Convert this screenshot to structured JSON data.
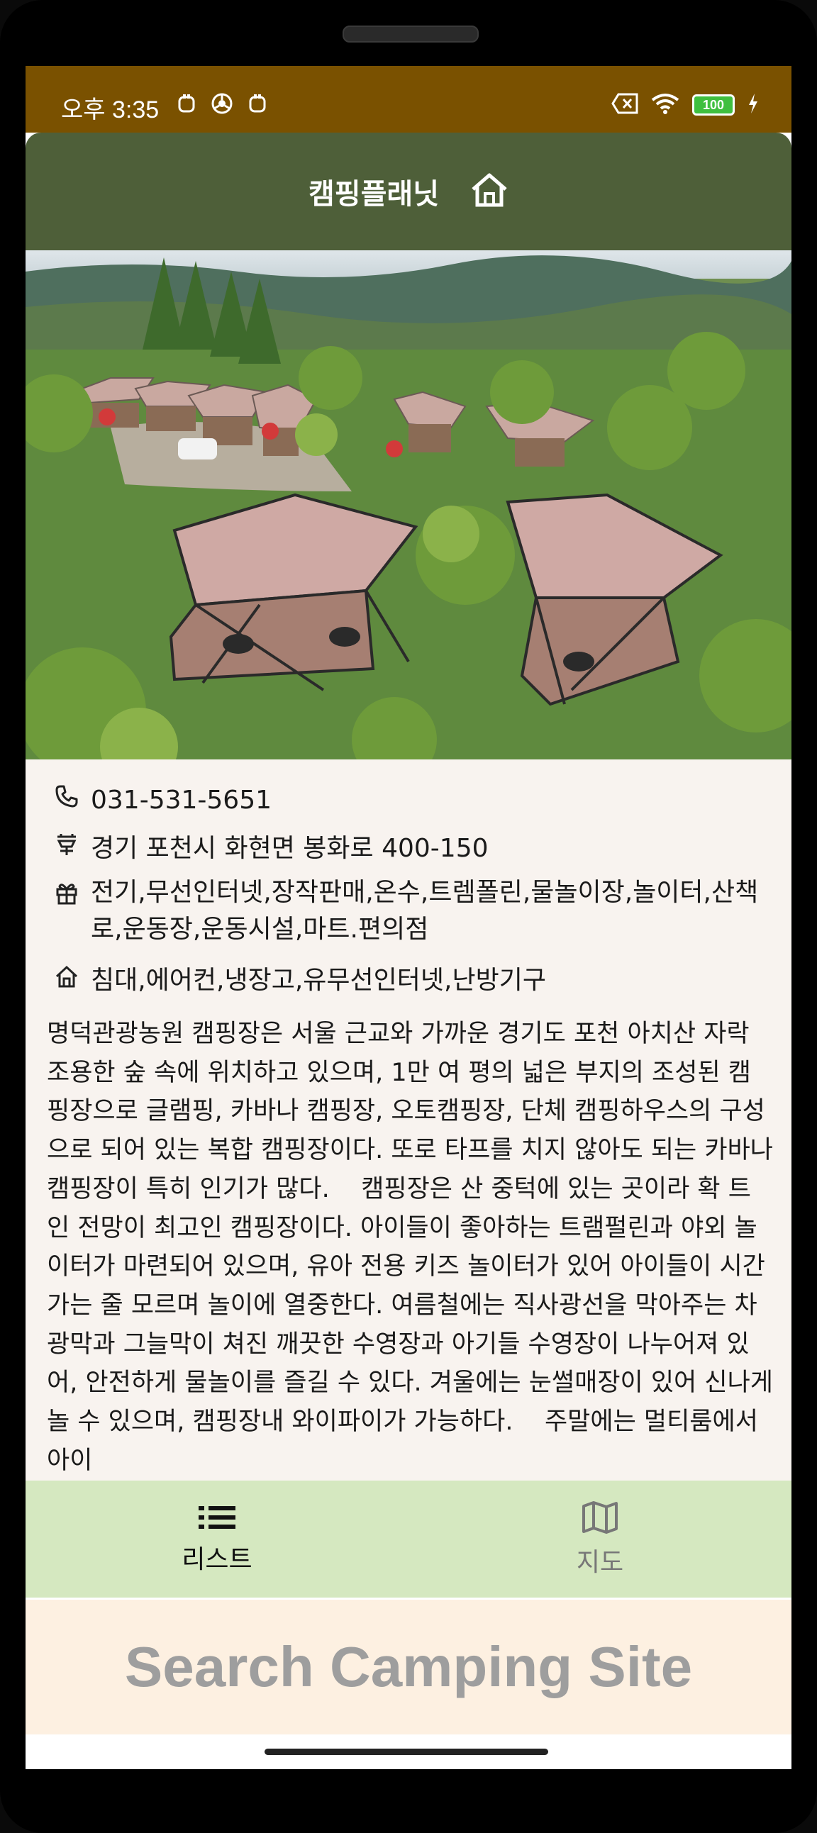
{
  "status_bar": {
    "time": "오후 3:35",
    "battery": "100"
  },
  "app_bar": {
    "title": "캠핑플래닛"
  },
  "details": {
    "phone": "031-531-5651",
    "address": "경기 포천시 화현면 봉화로 400-150",
    "amenities": "전기,무선인터넷,장작판매,온수,트렘폴린,물놀이장,놀이터,산책로,운동장,운동시설,마트.편의점",
    "facilities": "침대,에어컨,냉장고,유무선인터넷,난방기구",
    "description": "명덕관광농원 캠핑장은 서울 근교와 가까운 경기도 포천 아치산 자락 조용한 숲 속에 위치하고 있으며, 1만 여 평의 넓은 부지의 조성된 캠핑장으로 글램핑, 카바나 캠핑장, 오토캠핑장, 단체 캠핑하우스의 구성으로 되어 있는 복합 캠핑장이다. 또로 타프를 치지 않아도 되는 카바나 캠핑장이 특히 인기가 많다.    캠핑장은 산 중턱에 있는 곳이라 확 트인 전망이 최고인 캠핑장이다. 아이들이 좋아하는 트램펄린과 야외 놀이터가 마련되어 있으며, 유아 전용 키즈 놀이터가 있어 아이들이 시간가는 줄 모르며 놀이에 열중한다. 여름철에는 직사광선을 막아주는 차광막과 그늘막이 쳐진 깨끗한 수영장과 아기들 수영장이 나누어져 있어, 안전하게 물놀이를 즐길 수 있다. 겨울에는 눈썰매장이 있어 신나게 놀 수 있으며, 캠핑장내 와이파이가 가능하다.    주말에는 멀티룸에서 아이"
  },
  "bottom_nav": {
    "list_label": "리스트",
    "map_label": "지도"
  },
  "banner": {
    "text": "Search Camping Site"
  },
  "colors": {
    "status_bar": "#7a5100",
    "app_bar": "#4e5f39",
    "content_bg": "#f8f3ef",
    "nav_bg": "#d5e8c0",
    "banner_bg": "#fdf0e1",
    "banner_text": "#9e9e9e"
  }
}
